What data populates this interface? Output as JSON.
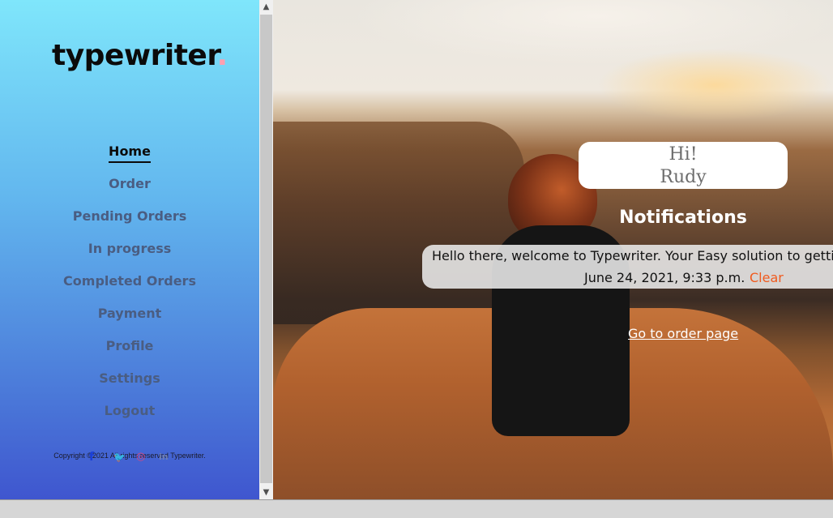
{
  "brand": {
    "name": "typewriter",
    "dot": ".",
    "dot_color": "#ff9fb0"
  },
  "nav": {
    "items": [
      {
        "label": "Home",
        "active": true
      },
      {
        "label": "Order"
      },
      {
        "label": "Pending Orders"
      },
      {
        "label": "In progress"
      },
      {
        "label": "Completed Orders"
      },
      {
        "label": "Payment"
      },
      {
        "label": "Profile"
      },
      {
        "label": "Settings"
      },
      {
        "label": "Logout"
      }
    ]
  },
  "footer": {
    "copyright": "Copyright ©2021 All rights reserved Typewriter."
  },
  "social_icons": [
    "facebook-icon",
    "twitter-icon",
    "instagram-icon",
    "linkedin-icon"
  ],
  "greeting": {
    "line1": "Hi!",
    "line2": "Rudy"
  },
  "notifications": {
    "title": "Notifications",
    "message": "Hello there, welcome to Typewriter. Your Easy solution to getti",
    "timestamp": "June 24, 2021, 9:33 p.m.",
    "clear_label": "Clear"
  },
  "order_link": "Go to order page",
  "colors": {
    "accent_clear": "#f05a1e",
    "sidebar_top": "#7fe6fb",
    "sidebar_bottom": "#3f56cf"
  }
}
